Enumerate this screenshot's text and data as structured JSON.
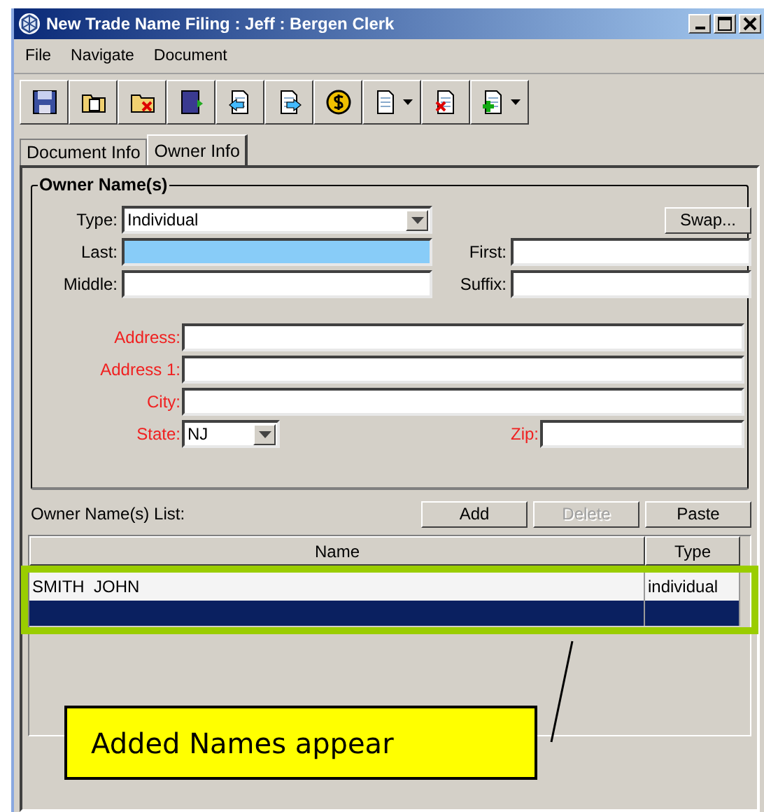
{
  "window": {
    "title": "New Trade Name Filing : Jeff : Bergen Clerk"
  },
  "menu": [
    "File",
    "Navigate",
    "Document"
  ],
  "tabs": [
    {
      "label": "Document Info",
      "selected": false
    },
    {
      "label": "Owner Info",
      "selected": true
    }
  ],
  "owner_names": {
    "title": "Owner Name(s)",
    "type": {
      "label": "Type:",
      "value": "Individual"
    },
    "swap_button": "Swap...",
    "name_fields": [
      {
        "label": "Last:",
        "focused": true
      },
      {
        "label": "First:",
        "focused": false
      },
      {
        "label": "Middle:",
        "focused": false
      },
      {
        "label": "Suffix:",
        "focused": false
      }
    ],
    "address_fields": [
      {
        "label": "Address:",
        "required": true
      },
      {
        "label": "Address 1:",
        "required": true
      },
      {
        "label": "City:",
        "required": true
      }
    ],
    "state": {
      "label": "State:",
      "value": "NJ",
      "required": true
    },
    "zip": {
      "label": "Zip:",
      "required": true
    }
  },
  "owner_list": {
    "label": "Owner Name(s) List:",
    "buttons": [
      {
        "label": "Add",
        "disabled": false
      },
      {
        "label": "Delete",
        "disabled": true
      },
      {
        "label": "Paste",
        "disabled": false
      }
    ],
    "columns": [
      "Name",
      "Type"
    ],
    "rows": [
      {
        "name": "SMITH  JOHN",
        "type": "individual",
        "selected": false
      },
      {
        "selected": true
      }
    ]
  },
  "annotation": {
    "callout": "Added Names appear"
  }
}
